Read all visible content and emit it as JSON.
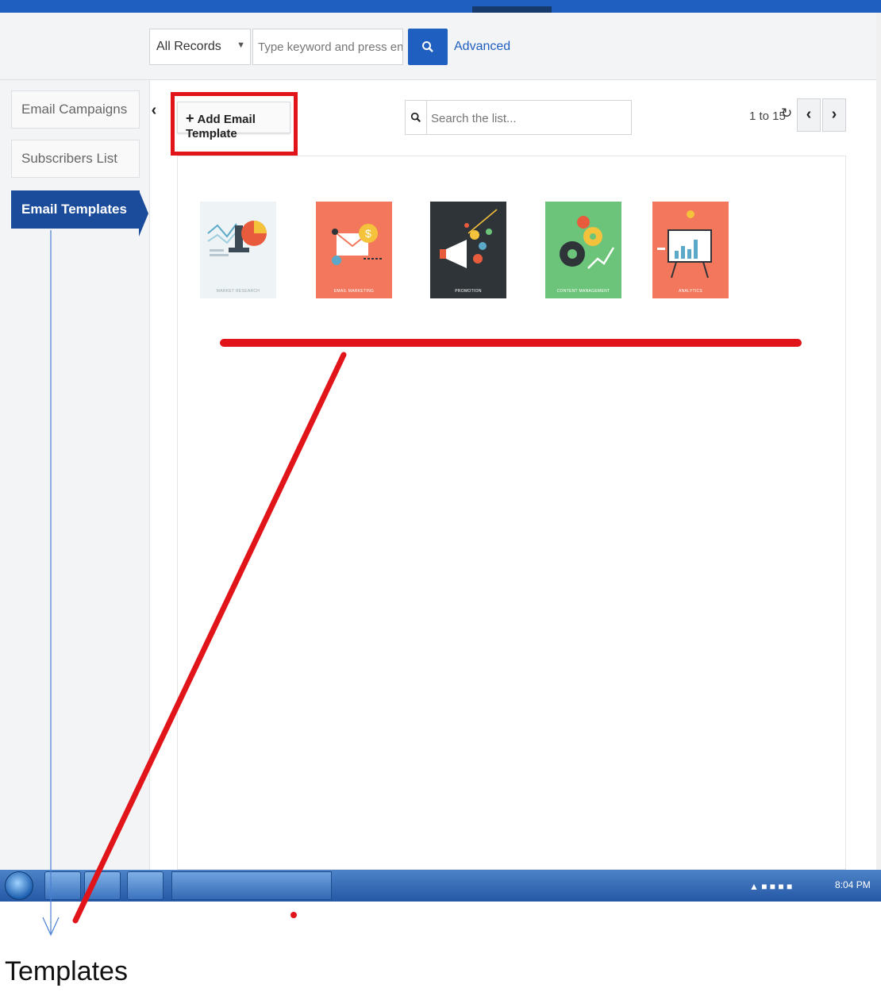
{
  "header": {
    "records_select": "All Records",
    "keyword_placeholder": "Type keyword and press enter",
    "advanced_label": "Advanced"
  },
  "sidebar": {
    "items": [
      {
        "label": "Email Campaigns",
        "active": false
      },
      {
        "label": "Subscribers List",
        "active": false
      },
      {
        "label": "Email Templates",
        "active": true
      }
    ]
  },
  "toolbar": {
    "add_template_label": "Add Email Template",
    "list_search_placeholder": "Search the list...",
    "range_label": "1 to 15",
    "icons": [
      "chevron-left-icon",
      "plus-icon",
      "search-icon",
      "refresh-icon",
      "chevron-right-icon"
    ]
  },
  "templates": [
    {
      "caption": "MARKET RESEARCH",
      "bg": "#eef3f5",
      "caption_color": "#9aa7ad"
    },
    {
      "caption": "EMAIL MARKETING",
      "bg": "#f2775c",
      "caption_color": "#ffffff"
    },
    {
      "caption": "PROMOTION",
      "bg": "#2f3438",
      "caption_color": "#ffffff"
    },
    {
      "caption": "CONTENT MANAGEMENT",
      "bg": "#6cc47a",
      "caption_color": "#ffffff"
    },
    {
      "caption": "ANALYTICS",
      "bg": "#f2775c",
      "caption_color": "#ffffff"
    }
  ],
  "taskbar": {
    "clock": "8:04 PM"
  },
  "annotations": {
    "caption": "Templates"
  },
  "colors": {
    "brand_blue": "#1f5fbf",
    "active_nav": "#1b4b9b",
    "annotation_red": "#e1141a"
  }
}
